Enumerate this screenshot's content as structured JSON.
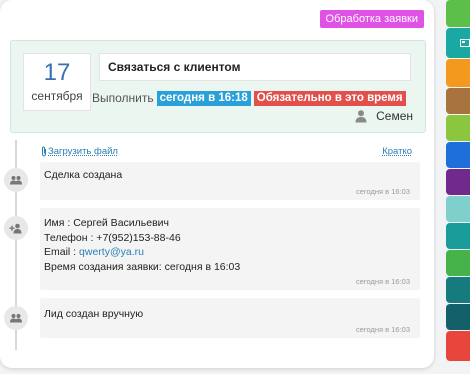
{
  "status_badge": "Обработка заявки",
  "task": {
    "day": "17",
    "month": "сентября",
    "title": "Связаться с клиентом",
    "execute_label": "Выполнить",
    "time_tag": "сегодня в 16:18",
    "must_tag": "Обязательно в это время",
    "assignee": "Семен"
  },
  "links": {
    "upload": "Загрузить файл",
    "brief": "Кратко"
  },
  "events": [
    {
      "lines": [
        "Сделка создана"
      ],
      "time": "сегодня в 16:03",
      "icon": "users-icon"
    },
    {
      "name_line": "Имя : Сергей Васильевич",
      "phone_line": "Телефон : +7(952)153-88-46",
      "email_label": "Email : ",
      "email_value": "qwerty@ya.ru",
      "created_line": "Время создания заявки: сегодня в 16:03",
      "time": "сегодня в 16:03",
      "icon": "add-user-icon"
    },
    {
      "lines": [
        "Лид создан вручную"
      ],
      "time": "сегодня в 16:03",
      "icon": "users-icon"
    }
  ],
  "colors": {
    "badge": "#e052e6",
    "time_tag": "#2aa0d8",
    "must_tag": "#e2504c",
    "right_tabs": [
      "#5cbf4a",
      "#19a9a2",
      "#f39a1e",
      "#a8733e",
      "#8cc63f",
      "#1e6fd9",
      "#6f2a8c",
      "#7fd0cc",
      "#1a9c9a",
      "#45b24a",
      "#167b7e",
      "#14606a",
      "#e8453c"
    ]
  }
}
